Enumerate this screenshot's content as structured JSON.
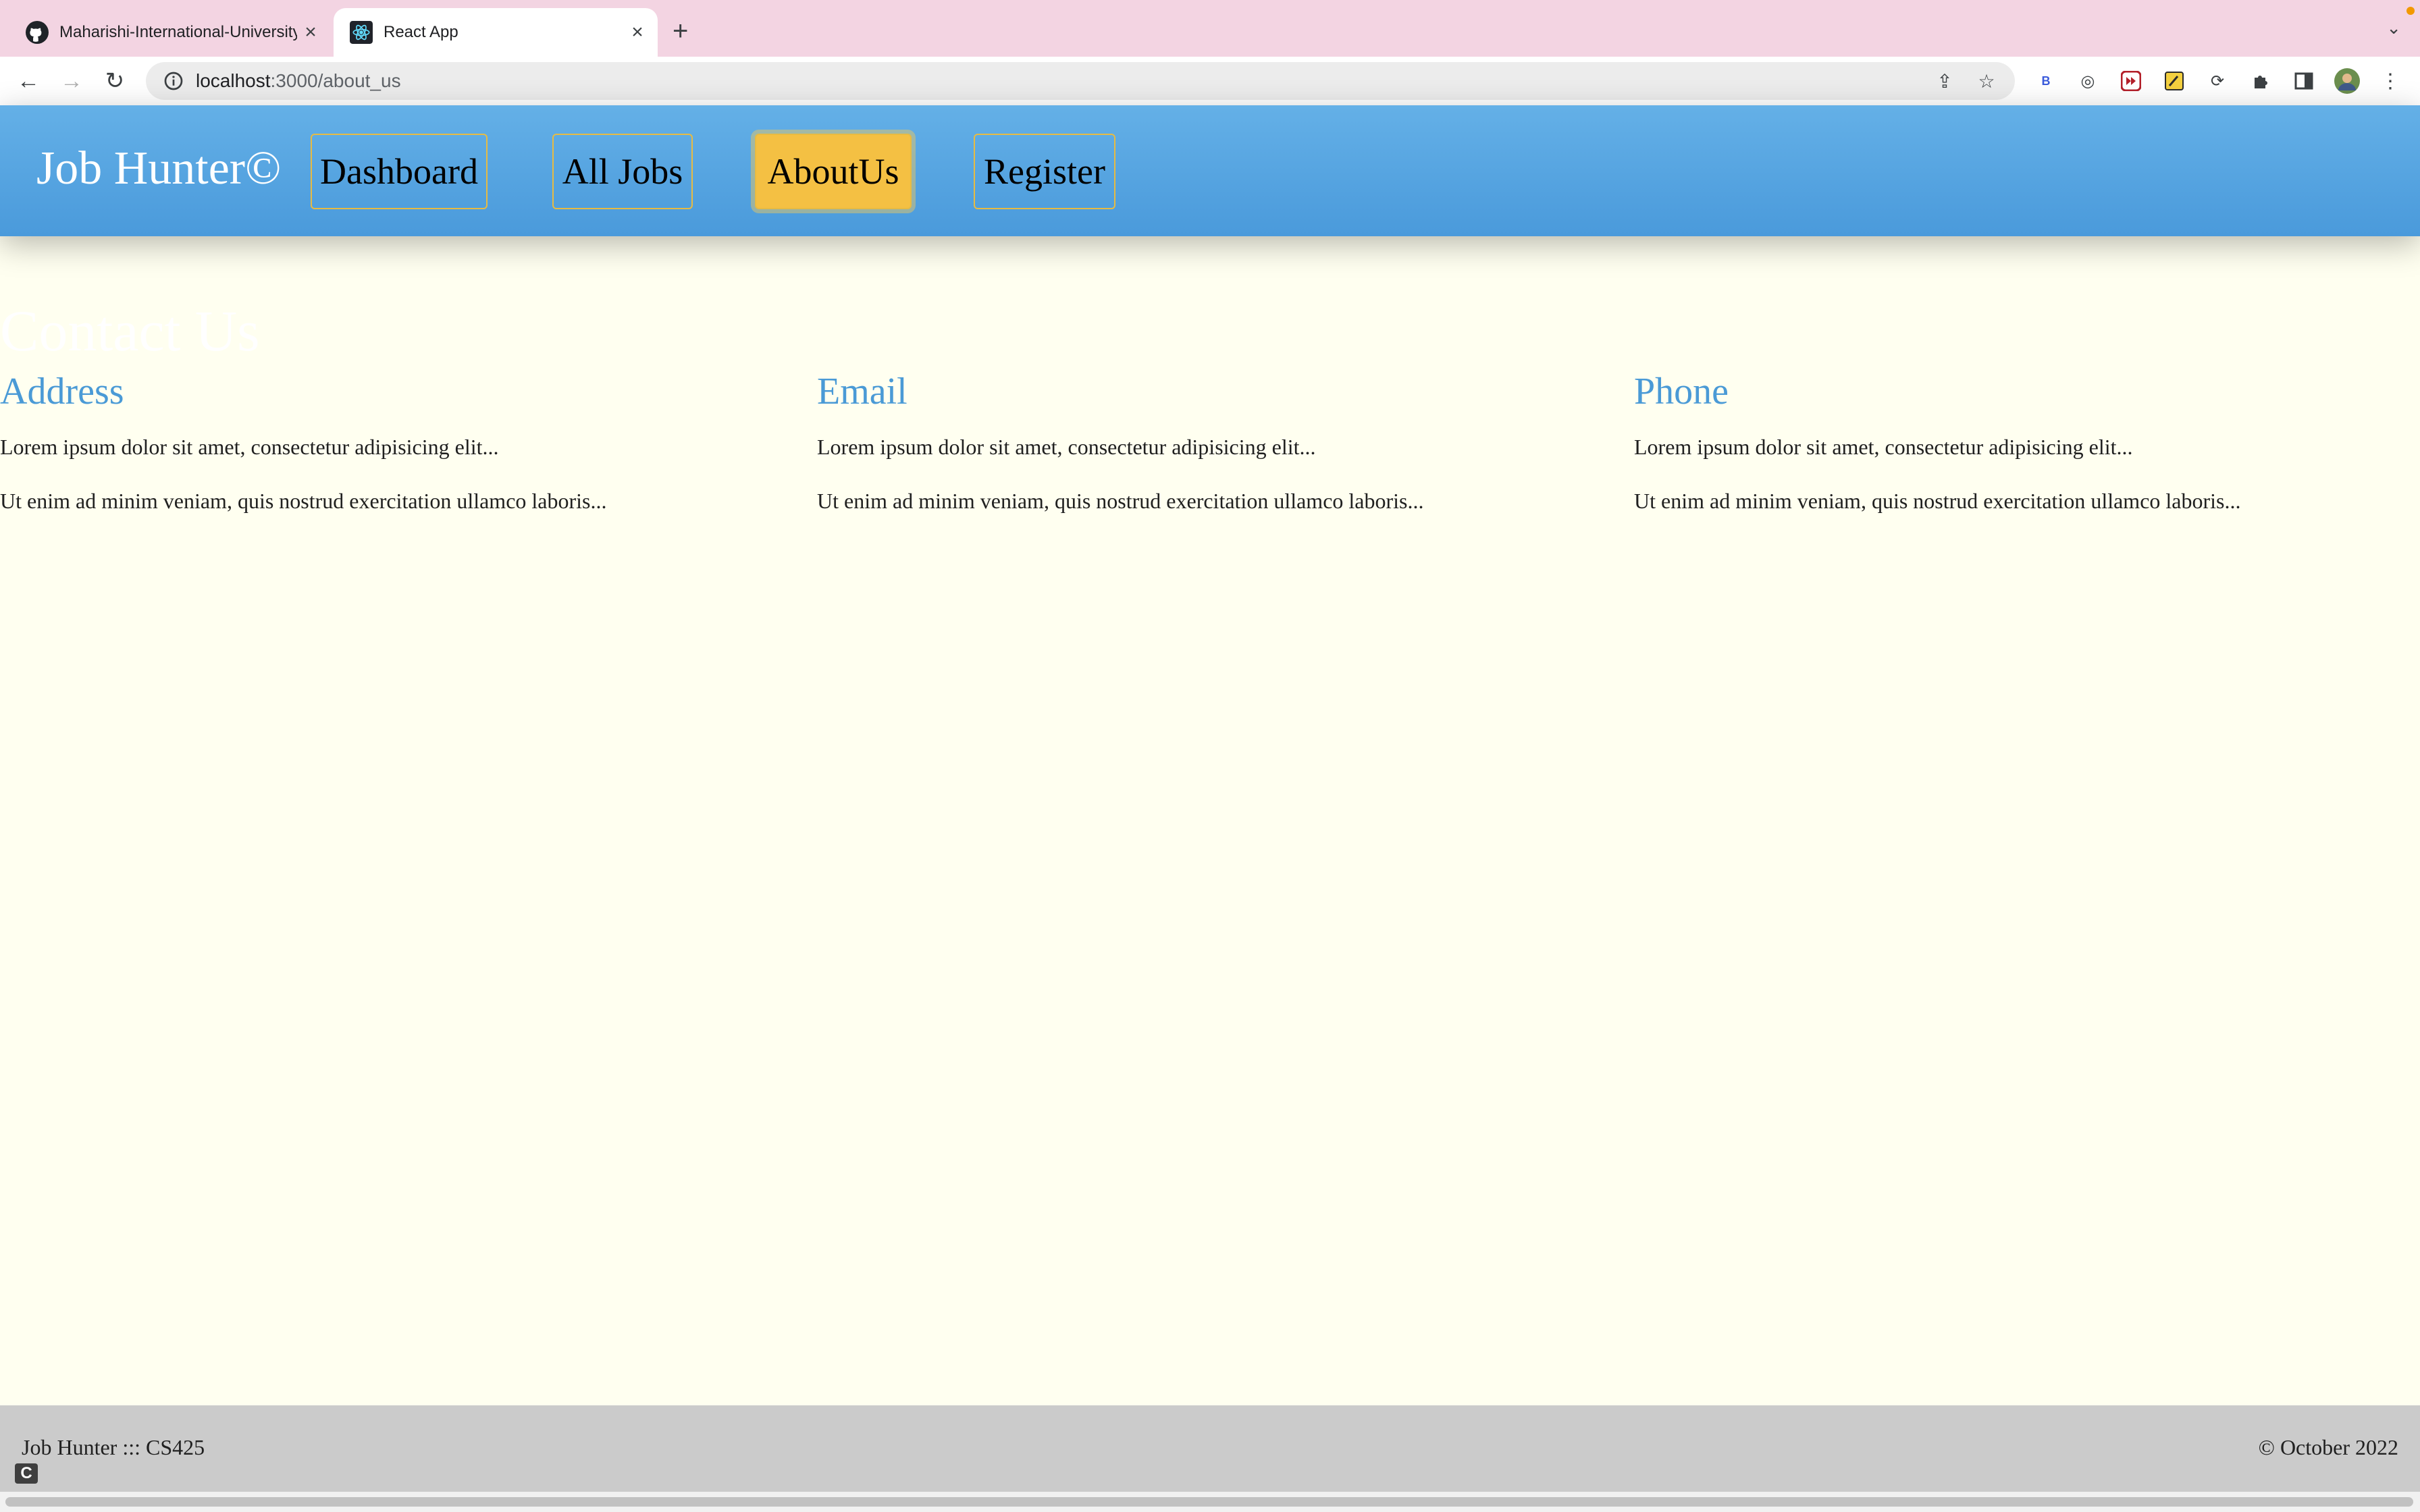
{
  "browser": {
    "tabs": [
      {
        "title": "Maharishi-International-University",
        "icon": "github-icon",
        "active": false
      },
      {
        "title": "React App",
        "icon": "react-icon",
        "active": true
      }
    ],
    "url_host": "localhost",
    "url_path": ":3000/about_us"
  },
  "nav": {
    "brand": "Job Hunter©",
    "links": [
      {
        "label": "Dashboard",
        "active": false
      },
      {
        "label": "All Jobs",
        "active": false
      },
      {
        "label": "AboutUs",
        "active": true
      },
      {
        "label": "Register",
        "active": false
      }
    ]
  },
  "content": {
    "heading": "Contact Us",
    "columns": [
      {
        "title": "Address",
        "line1": "Lorem ipsum dolor sit amet, consectetur adipisicing elit...",
        "line2": "Ut enim ad minim veniam, quis nostrud exercitation ullamco laboris..."
      },
      {
        "title": "Email",
        "line1": "Lorem ipsum dolor sit amet, consectetur adipisicing elit...",
        "line2": "Ut enim ad minim veniam, quis nostrud exercitation ullamco laboris..."
      },
      {
        "title": "Phone",
        "line1": "Lorem ipsum dolor sit amet, consectetur adipisicing elit...",
        "line2": "Ut enim ad minim veniam, quis nostrud exercitation ullamco laboris..."
      }
    ]
  },
  "footer": {
    "left": "Job Hunter ::: CS425",
    "right": "© October 2022",
    "logo_text": "C"
  },
  "colors": {
    "nav_bg": "#4a9adb",
    "active_link": "#f4c043",
    "column_title": "#4a9ad6",
    "page_bg": "#fffff0",
    "footer_bg": "#cbcbcb",
    "tabstrip_bg": "#f3d4e2"
  }
}
